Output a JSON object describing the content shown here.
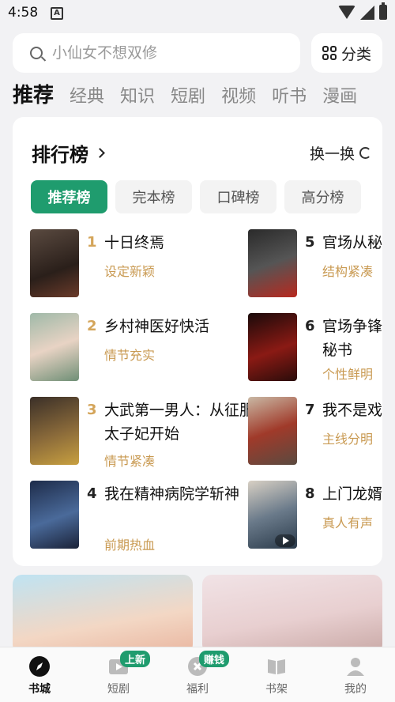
{
  "status_bar": {
    "time": "4:58",
    "a_icon": "A"
  },
  "search": {
    "placeholder": "小仙女不想双修"
  },
  "category": {
    "label": "分类"
  },
  "tabs": [
    "推荐",
    "经典",
    "知识",
    "短剧",
    "视频",
    "听书",
    "漫画"
  ],
  "ranking": {
    "title": "排行榜",
    "refresh_label": "换一换",
    "chips": [
      "推荐榜",
      "完本榜",
      "口碑榜",
      "高分榜"
    ],
    "books": [
      {
        "rank": "1",
        "title": "十日终焉",
        "tag": "设定新颖"
      },
      {
        "rank": "2",
        "title": "乡村神医好快活",
        "tag": "情节充实"
      },
      {
        "rank": "3",
        "title": "大武第一男人：从征服太子妃开始",
        "tag": "情节紧凑"
      },
      {
        "rank": "4",
        "title": "我在精神病院学斩神",
        "tag": "前期热血"
      },
      {
        "rank": "5",
        "title": "官场从秘",
        "tag": "结构紧凑"
      },
      {
        "rank": "6",
        "title": "官场争锋记的秘书",
        "tag": "个性鲜明"
      },
      {
        "rank": "7",
        "title": "我不是戏",
        "tag": "主线分明"
      },
      {
        "rank": "8",
        "title": "上门龙婿",
        "tag": "真人有声"
      }
    ]
  },
  "bottom_nav": [
    {
      "label": "书城",
      "icon": "compass-icon"
    },
    {
      "label": "短剧",
      "icon": "play-icon",
      "badge": "上新"
    },
    {
      "label": "福利",
      "icon": "coin-icon",
      "badge": "赚钱"
    },
    {
      "label": "书架",
      "icon": "book-icon"
    },
    {
      "label": "我的",
      "icon": "user-icon"
    }
  ],
  "colors": {
    "accent": "#1f9c6e",
    "tag": "#c99a52",
    "rank_top": "#d4a55a"
  }
}
